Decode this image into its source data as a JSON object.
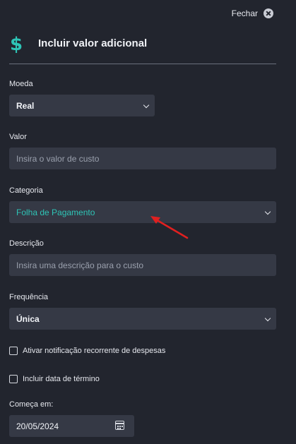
{
  "close": {
    "label": "Fechar",
    "icon": "close-circle-icon"
  },
  "header": {
    "icon": "dollar-icon",
    "title": "Incluir valor adicional",
    "accent": "#2ec4b6"
  },
  "form": {
    "moeda": {
      "label": "Moeda",
      "value": "Real"
    },
    "valor": {
      "label": "Valor",
      "placeholder": "Insira o valor de custo"
    },
    "categoria": {
      "label": "Categoria",
      "value": "Folha de Pagamento"
    },
    "descricao": {
      "label": "Descrição",
      "placeholder": "Insira uma descrição para o custo"
    },
    "frequencia": {
      "label": "Frequência",
      "value": "Única"
    },
    "notificacao": {
      "label": "Ativar notificação recorrente de despesas",
      "checked": false
    },
    "data_termino": {
      "label": "Incluir data de término",
      "checked": false
    },
    "comeca_em": {
      "label": "Começa em:",
      "value": "20/05/2024",
      "icon": "calendar-icon"
    }
  },
  "annotation": {
    "icon": "red-arrow-icon",
    "color": "#e02020"
  }
}
